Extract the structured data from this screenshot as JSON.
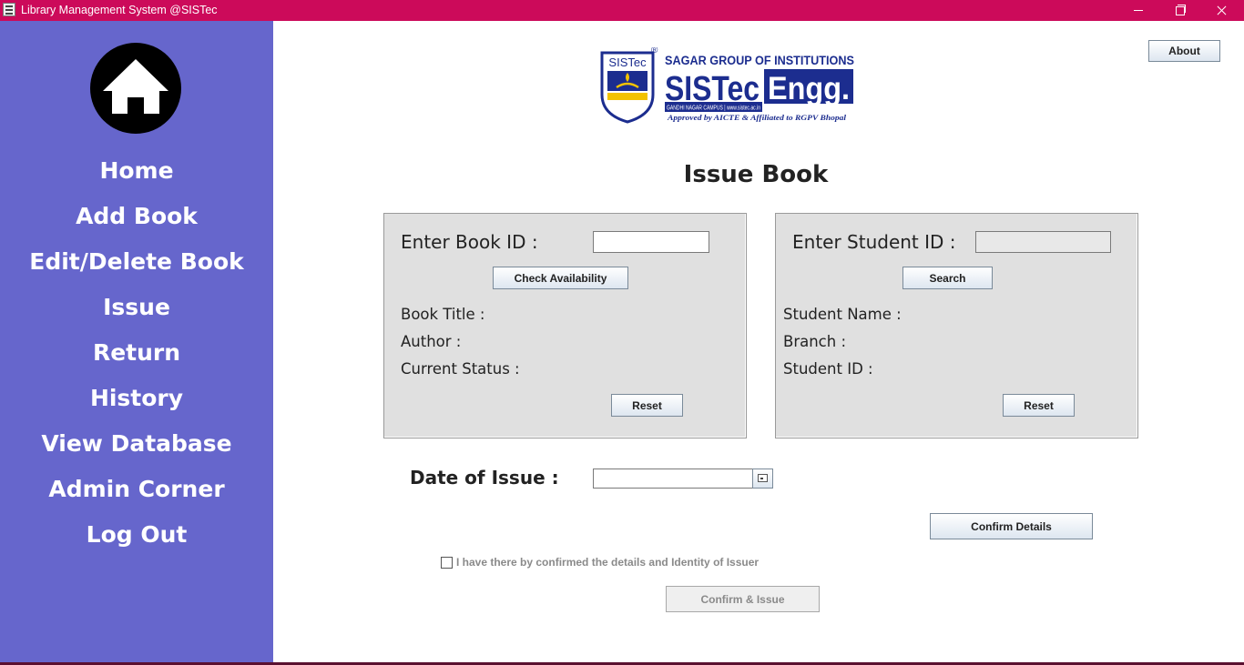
{
  "window": {
    "title": "Library Management System @SISTec"
  },
  "sidebar": {
    "items": [
      {
        "label": "Home"
      },
      {
        "label": "Add Book"
      },
      {
        "label": "Edit/Delete Book"
      },
      {
        "label": "Issue"
      },
      {
        "label": "Return"
      },
      {
        "label": "History"
      },
      {
        "label": "View Database"
      },
      {
        "label": "Admin Corner"
      },
      {
        "label": "Log Out"
      }
    ],
    "background": "#6666cc"
  },
  "logo": {
    "badge": "SISTec",
    "group": "SAGAR GROUP OF INSTITUTIONS",
    "name_part1": "SISTec",
    "name_part2": "Engg.",
    "campus": "GANDHI NAGAR CAMPUS | www.sistec.ac.in",
    "approval": "Approved by AICTE & Affiliated to RGPV Bhopal",
    "registered_mark": "®"
  },
  "header": {
    "about_label": "About",
    "page_title": "Issue Book"
  },
  "book_panel": {
    "id_label": "Enter Book ID :",
    "id_value": "",
    "check_label": "Check Availability",
    "title_label": "Book Title :",
    "author_label": "Author :",
    "status_label": "Current Status :",
    "reset_label": "Reset"
  },
  "student_panel": {
    "id_label": "Enter Student ID :",
    "id_value": "",
    "search_label": "Search",
    "name_label": "Student Name :",
    "branch_label": "Branch :",
    "student_id_label": "Student ID :",
    "reset_label": "Reset"
  },
  "issue": {
    "date_label": "Date of Issue :",
    "date_value": "",
    "confirm_details_label": "Confirm Details",
    "checkbox_label": "I have there by confirmed the details and Identity of Issuer",
    "checkbox_checked": false,
    "confirm_issue_label": "Confirm & Issue"
  },
  "colors": {
    "titlebar": "#cc0a5a",
    "sidebar": "#6666cc",
    "panel": "#e0e0e0",
    "logo_blue": "#1c2d8f"
  }
}
